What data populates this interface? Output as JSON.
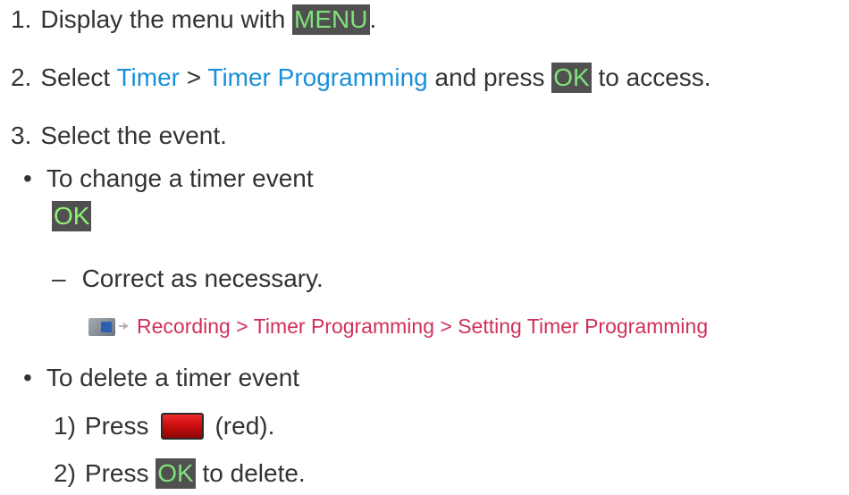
{
  "steps": [
    {
      "num": "1.",
      "t1": "Display the menu with ",
      "key": "MENU",
      "t2": "."
    },
    {
      "num": "2.",
      "t1": "Select ",
      "link1": "Timer",
      "sep": " > ",
      "link2": "Timer Programming",
      "t2": " and press ",
      "key": "OK",
      "t3": " to access."
    },
    {
      "num": "3.",
      "t1": "Select the event."
    }
  ],
  "change": {
    "bullet": "•",
    "title": "To change a timer event",
    "key": "OK",
    "dash": "–",
    "note": "Correct as necessary.",
    "ref_text": "Recording > Timer Programming > Setting Timer Programming"
  },
  "delete": {
    "bullet": "•",
    "title": "To delete a timer event",
    "s1_num": "1)",
    "s1_t1": "Press",
    "s1_t2": "(red).",
    "s2_num": "2)",
    "s2_t1": "Press ",
    "s2_key": "OK",
    "s2_t2": " to delete."
  },
  "colors": {
    "text": "#333333",
    "link": "#1a8fd8",
    "reference": "#d0305a",
    "key_bg": "#505050",
    "key_fg": "#80e27a",
    "red_button": "#d41414"
  },
  "icons": {
    "reference": "tv-reference-icon",
    "arrow": "arrow-right-icon",
    "red_button": "red-remote-button-icon"
  }
}
